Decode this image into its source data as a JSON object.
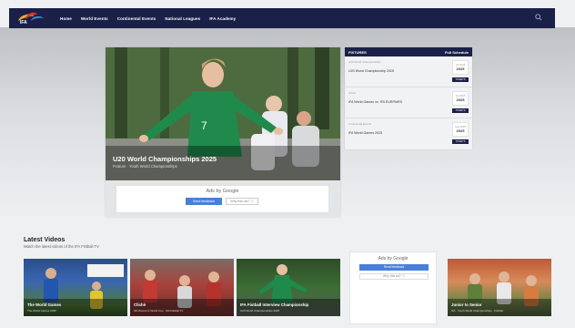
{
  "nav": {
    "logo_text": "IFA",
    "links": [
      "Home",
      "World Events",
      "Continental Events",
      "National Leagues",
      "IFA Academy"
    ]
  },
  "hero": {
    "title": "U20 World Championships 2025",
    "subtitle": "Feature · Youth World Championships",
    "ad": {
      "label": "Ads by Google",
      "send_feedback": "Send feedback",
      "why_this_ad": "Why this ad? ⓘ"
    }
  },
  "fixtures": {
    "title": "FIXTURES",
    "link": "Full Schedule",
    "rows": [
      {
        "competition": "U20 World Championships",
        "match": "U20 World Championship 2025",
        "month": "Jul 2025",
        "day": "2025",
        "button": "TICKETS"
      },
      {
        "competition": "World",
        "match": "IFA World Games vs. IFA EURPAIRS",
        "month": "Jul 2025",
        "day": "2025",
        "button": "TICKETS"
      },
      {
        "competition": "Continental Events",
        "match": "IFA World Games 2025",
        "month": "Aug 2025",
        "day": "2025",
        "button": "TICKETS"
      }
    ]
  },
  "latest_videos": {
    "title": "Latest Videos",
    "subtitle": "Watch the latest videos of the IFA Fistball TV",
    "items": [
      {
        "title": "The World Games",
        "subtitle": "The World Games 2025"
      },
      {
        "title": "Clichè",
        "subtitle": "IFA Women's World Cup · IFA Fistball TV"
      },
      {
        "title": "IFA Fistball Interview Championship",
        "subtitle": "U20 World Championships 2025"
      },
      {
        "title": "Junior to Senior",
        "subtitle": "IFA · Youth World Championships · Fistball"
      }
    ],
    "ad": {
      "label": "Ads by Google",
      "send_feedback": "Send feedback",
      "why_this_ad": "Why this ad? ⓘ"
    }
  },
  "colors": {
    "nav_bg": "#1a2048",
    "ad_button": "#4a7fd9"
  },
  "icons": {
    "search": "search-icon"
  }
}
